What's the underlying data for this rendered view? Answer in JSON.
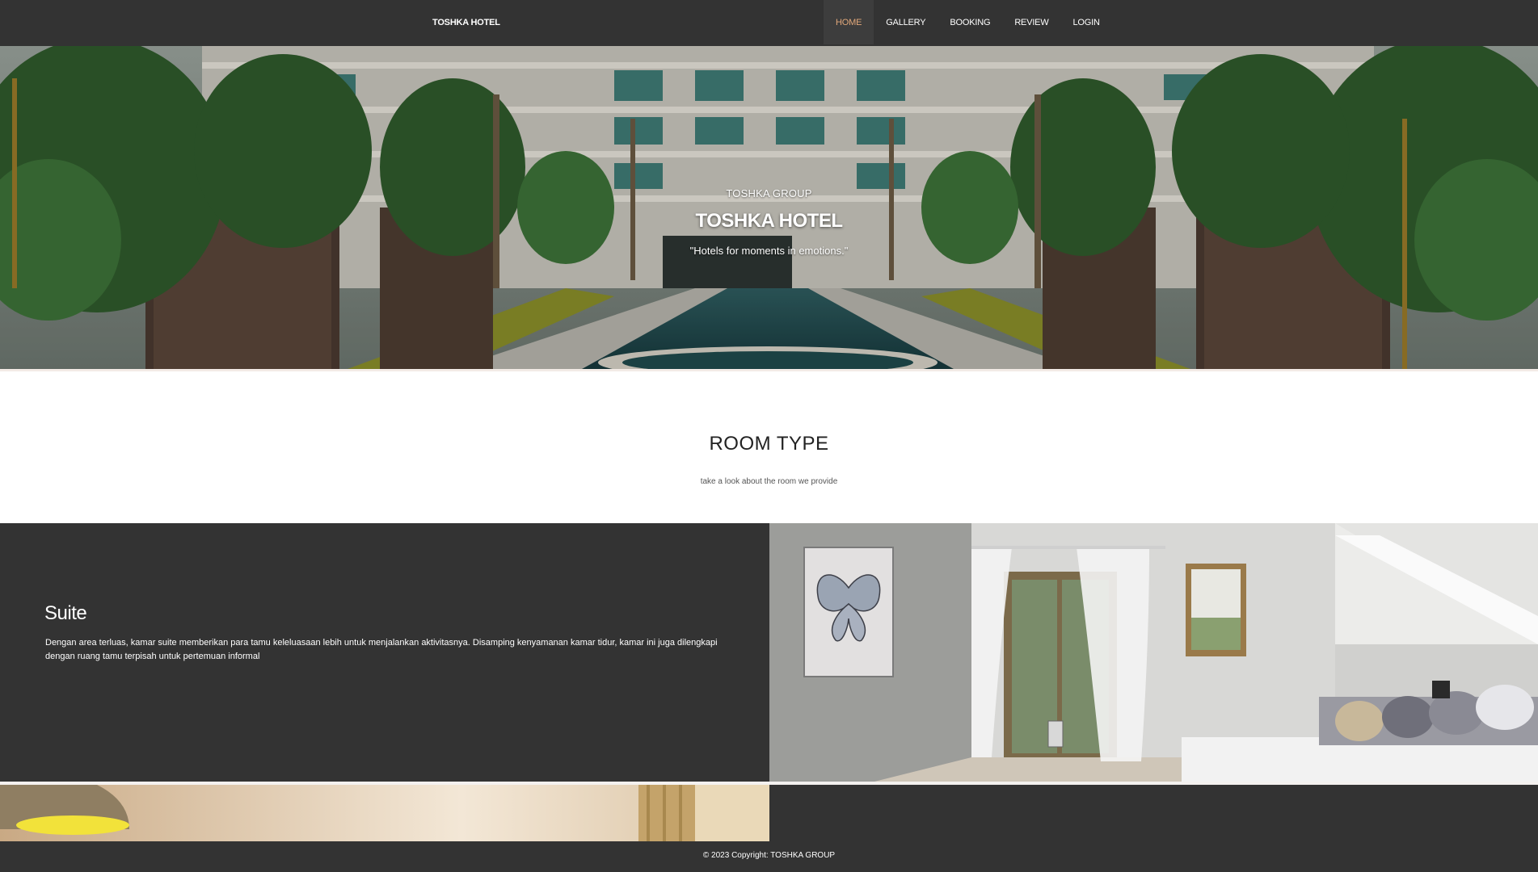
{
  "navbar": {
    "brand": "TOSHKA HOTEL",
    "items": [
      {
        "label": "HOME",
        "active": true
      },
      {
        "label": "GALLERY",
        "active": false
      },
      {
        "label": "BOOKING",
        "active": false
      },
      {
        "label": "REVIEW",
        "active": false
      },
      {
        "label": "LOGIN",
        "active": false
      }
    ]
  },
  "hero": {
    "subtitle": "TOSHKA GROUP",
    "title": "TOSHKA HOTEL",
    "tagline": "\"Hotels for moments in emotions.\""
  },
  "room_section": {
    "title": "ROOM TYPE",
    "subtitle": "take a look about the room we provide"
  },
  "rooms": [
    {
      "name": "Suite",
      "description": "Dengan area terluas, kamar suite memberikan para tamu keleluasaan lebih untuk menjalankan aktivitasnya. Disamping kenyamanan kamar tidur, kamar ini juga dilengkapi dengan ruang tamu terpisah untuk pertemuan informal"
    }
  ],
  "footer": {
    "copyright": "© 2023 Copyright: TOSHKA GROUP"
  },
  "colors": {
    "nav_bg": "#333333",
    "nav_active_text": "#e0a77a",
    "text_light": "#ffffff",
    "section_bg": "#333333"
  }
}
